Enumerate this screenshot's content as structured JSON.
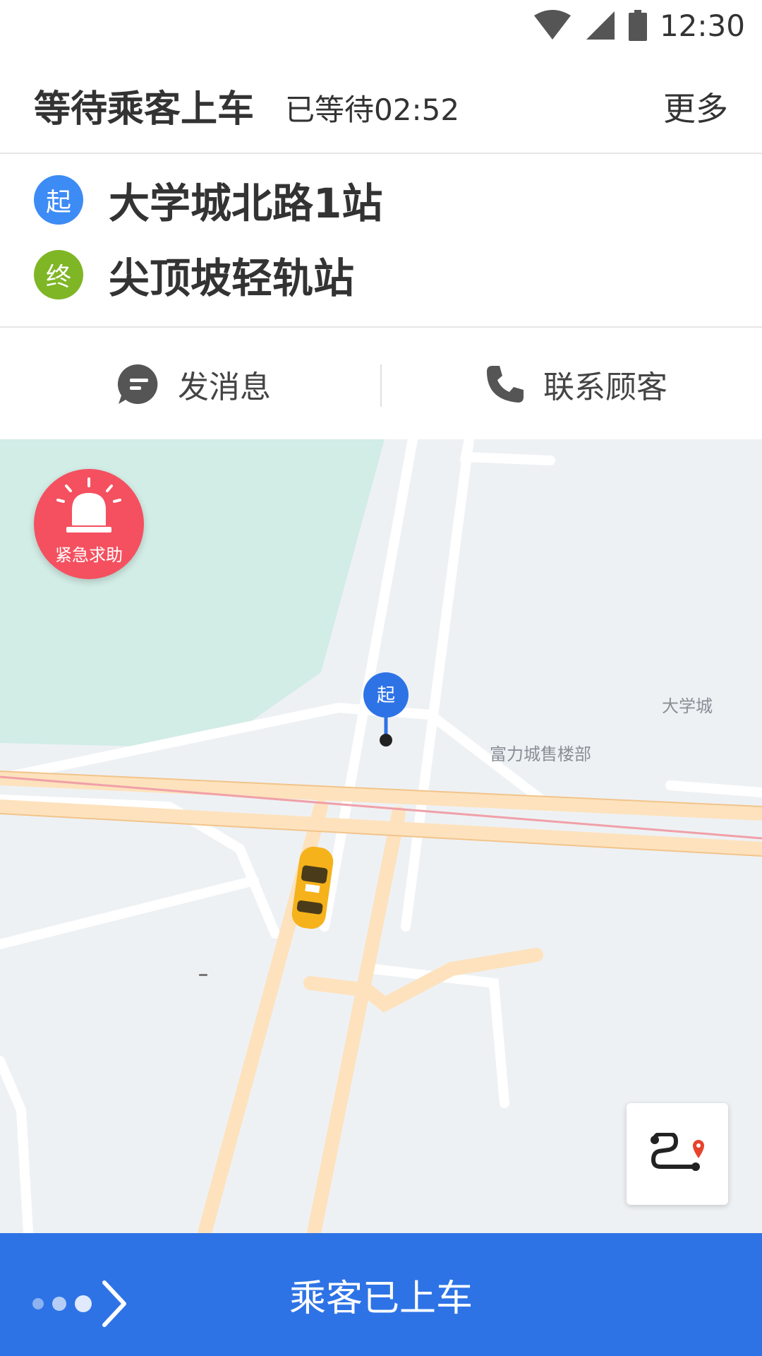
{
  "status_bar": {
    "time": "12:30",
    "icons": [
      "wifi-icon",
      "cell-signal-icon",
      "battery-icon"
    ]
  },
  "header": {
    "title": "等待乘客上车",
    "wait_text": "已等待02:52",
    "more_label": "更多"
  },
  "route": {
    "start": {
      "badge": "起",
      "name": "大学城北路1站",
      "color": "#3d8bf5"
    },
    "end": {
      "badge": "终",
      "name": "尖顶坡轻轨站",
      "color": "#7fb625"
    }
  },
  "actions": {
    "message": {
      "label": "发消息",
      "icon": "chat-bubble-icon"
    },
    "call": {
      "label": "联系顾客",
      "icon": "phone-icon"
    }
  },
  "map": {
    "sos_label": "紧急求助",
    "pickup_marker_label": "起",
    "poi_labels": [
      "大学城",
      "富力城售楼部"
    ],
    "route_button_icon": "route-icon"
  },
  "bottom_bar": {
    "label": "乘客已上车",
    "color": "#2e73e6"
  }
}
